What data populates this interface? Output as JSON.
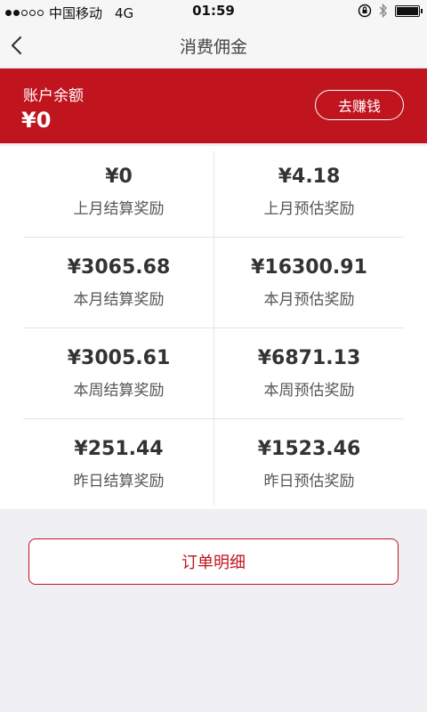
{
  "status_bar": {
    "carrier": "中国移动",
    "network": "4G",
    "time": "01:59"
  },
  "nav": {
    "title": "消费佣金",
    "back_icon": "chevron-left-icon"
  },
  "balance": {
    "label": "账户余额",
    "amount": "¥0",
    "earn_button": "去赚钱"
  },
  "rewards": [
    {
      "amount": "¥0",
      "label": "上月结算奖励"
    },
    {
      "amount": "¥4.18",
      "label": "上月预估奖励"
    },
    {
      "amount": "¥3065.68",
      "label": "本月结算奖励"
    },
    {
      "amount": "¥16300.91",
      "label": "本月预估奖励"
    },
    {
      "amount": "¥3005.61",
      "label": "本周结算奖励"
    },
    {
      "amount": "¥6871.13",
      "label": "本周预估奖励"
    },
    {
      "amount": "¥251.44",
      "label": "昨日结算奖励"
    },
    {
      "amount": "¥1523.46",
      "label": "昨日预估奖励"
    }
  ],
  "order_button": "订单明细",
  "colors": {
    "accent": "#c0141f",
    "background": "#efeff4"
  }
}
